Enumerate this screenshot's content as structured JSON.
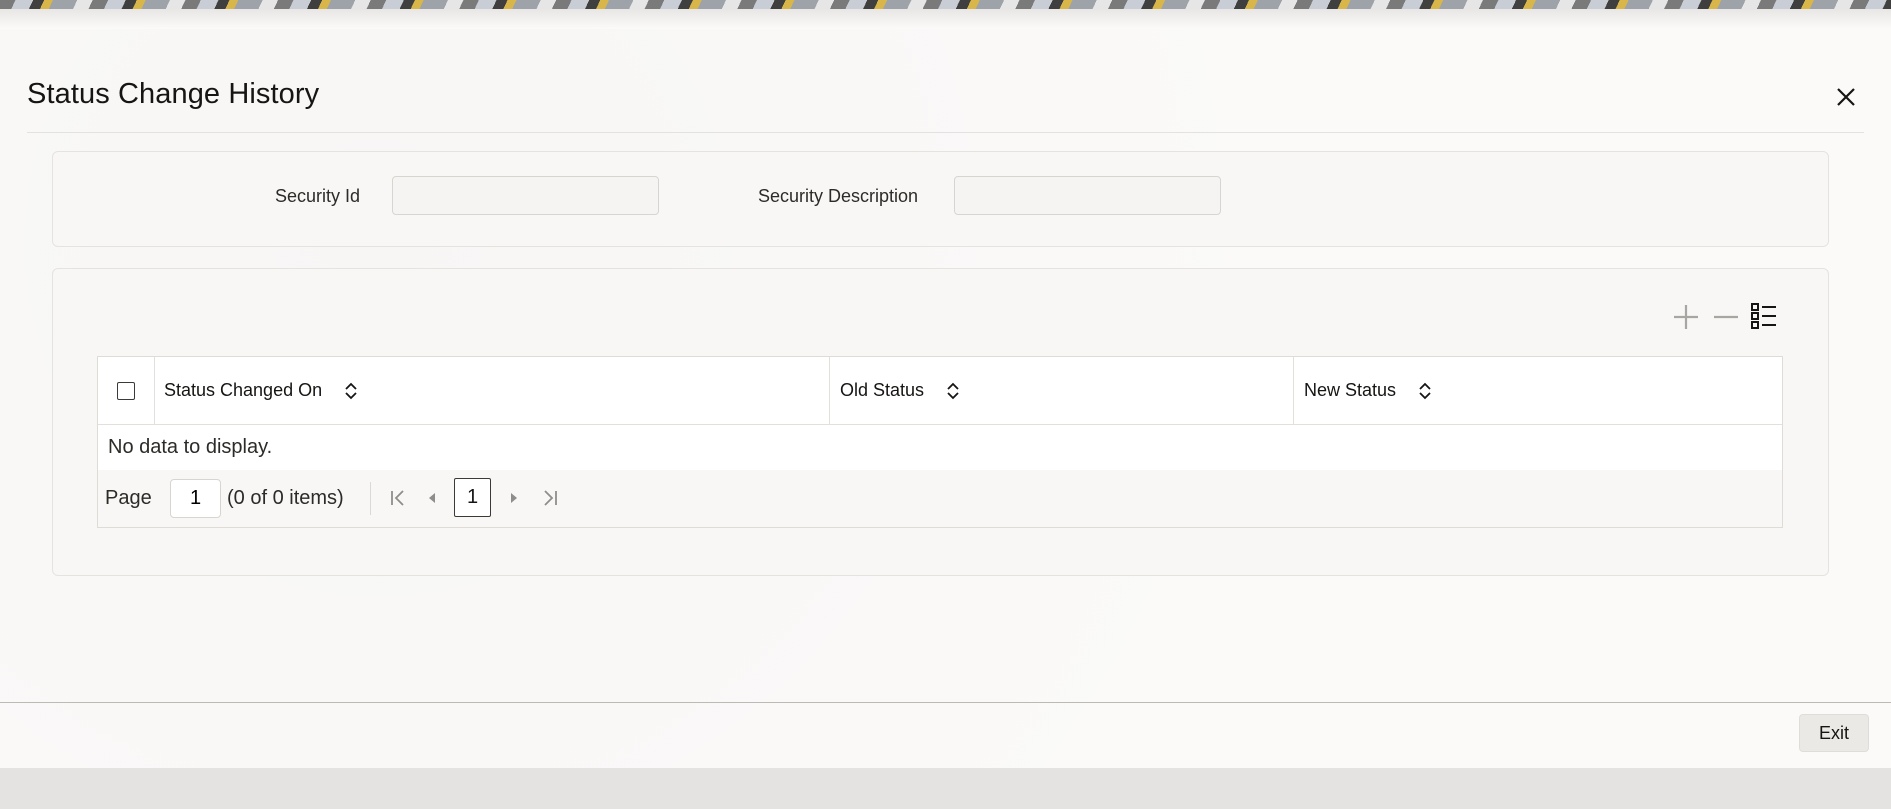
{
  "dialog": {
    "title": "Status Change History",
    "close_icon": "close-icon"
  },
  "search": {
    "security_id_label": "Security Id",
    "security_id_value": "",
    "security_description_label": "Security Description",
    "security_description_value": ""
  },
  "grid_toolbar": {
    "icons": [
      "add-row-icon",
      "delete-row-icon",
      "single-record-view-icon"
    ]
  },
  "grid": {
    "columns": [
      {
        "label": "Status Changed On"
      },
      {
        "label": "Old Status"
      },
      {
        "label": "New Status"
      }
    ],
    "rows": [],
    "empty_message": "No data to display."
  },
  "pagination": {
    "page_label": "Page",
    "page_value": "1",
    "items_summary": "(0 of 0 items)",
    "current_page": "1"
  },
  "footer": {
    "exit_label": "Exit"
  },
  "colors": {
    "text": "#161513",
    "panel": "#f8f7f5",
    "border": "#dfdcd8",
    "icon_disabled": "#a8a6a3"
  }
}
